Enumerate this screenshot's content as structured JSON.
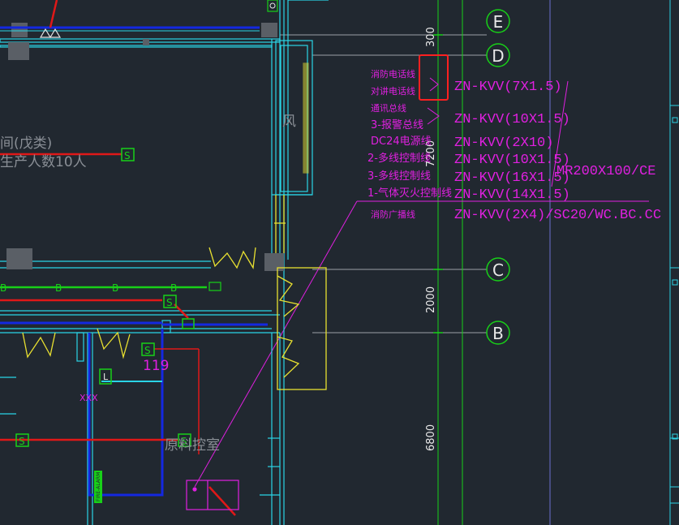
{
  "grid_axes": [
    {
      "id": "axis-e",
      "label": "E"
    },
    {
      "id": "axis-d",
      "label": "D"
    },
    {
      "id": "axis-c",
      "label": "C"
    },
    {
      "id": "axis-b",
      "label": "B"
    }
  ],
  "dimensions": [
    "300",
    "7200",
    "2000",
    "6800"
  ],
  "cable_labels": [
    {
      "cn": "消防电话线",
      "spec": "ZN-KVV(7X1.5)"
    },
    {
      "cn": "对讲电话线",
      "spec": ""
    },
    {
      "cn": "通讯总线",
      "spec": "ZN-KVV(10X1.5)"
    },
    {
      "cn": "3-报警总线",
      "spec": ""
    },
    {
      "cn": "DC24电源线",
      "spec": "ZN-KVV(2X10)"
    },
    {
      "cn": "2-多线控制线",
      "spec": "ZN-KVV(10X1.5)"
    },
    {
      "cn": "3-多线控制线",
      "spec": "ZN-KVV(16X1.5)"
    },
    {
      "cn": "1-气体灭火控制线",
      "spec": "ZN-KVV(14X1.5)"
    },
    {
      "cn": "消防广播线",
      "spec": "ZN-KVV(2X4)/SC20/WC.BC.CC"
    }
  ],
  "tray_spec": "MR200X100/CE",
  "room_labels": {
    "room_type": "间(戊类)",
    "occupancy": "生产人数10人",
    "wind": "风",
    "control_room": "原料控室",
    "device_119": "119",
    "xxx": "XXX"
  },
  "symbols": {
    "s": "S",
    "b": "B",
    "l": "L",
    "fire_panel": "FIRE-ALARM"
  },
  "colors": {
    "background": "#212830",
    "magenta": "#e020e0",
    "cyan": "#2ad4e6",
    "green": "#18d018",
    "red": "#e01818",
    "blue": "#1428e0",
    "yellow": "#e8e030",
    "white": "#e8e8e8",
    "highlight": "#ff2020"
  }
}
